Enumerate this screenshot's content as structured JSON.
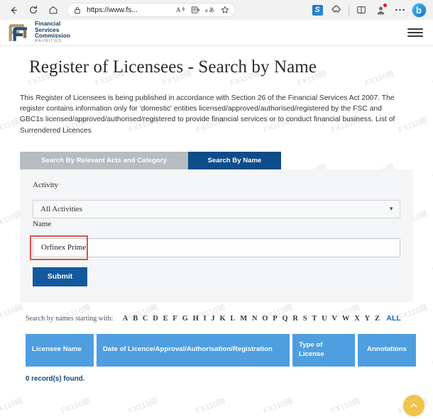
{
  "browser": {
    "back_icon": "back-arrow-icon",
    "reload_icon": "reload-icon",
    "home_icon": "home-icon",
    "lock_icon": "lock-icon",
    "url": "https://www.fs...",
    "read_aloud_icon": "read-aloud-icon",
    "immersive_reader_icon": "immersive-reader-icon",
    "translate_icon": "translate-icon",
    "favorite_icon": "favorite-star-icon",
    "extension_icon_label": "S",
    "extensions_icon": "extensions-puzzle-icon",
    "split_screen_icon": "split-screen-icon",
    "profile_icon": "profile-avatar-icon",
    "settings_more_icon": "more-options-icon",
    "copilot_icon_label": "b"
  },
  "site": {
    "logo": {
      "line1": "Financial",
      "line2": "Services",
      "line3": "Commission",
      "subtitle": "MAURITIUS"
    },
    "menu_icon": "hamburger-menu-icon"
  },
  "main": {
    "title": "Register of Licensees - Search by Name",
    "intro": "This Register of Licensees is being published in accordance with Section 26 of the Financial Services Act 2007. The register contains information only for 'domestic' entities licensed/approved/authorised/registered by the FSC and GBC1s licensed/approved/authorised/registered to provide financial services or to conduct financial business. List of Surrendered Licences",
    "tabs": [
      {
        "label": "Search By Relevant Acts and Category",
        "active": false
      },
      {
        "label": "Search By Name",
        "active": true
      }
    ],
    "form": {
      "activity_label": "Activity",
      "activity_value": "All Activities",
      "activity_caret_icon": "chevron-down-icon",
      "name_label": "Name",
      "name_value": "Orfinex Prime",
      "name_placeholder": "",
      "submit_label": "Submit"
    },
    "alpha": {
      "label": "Search by names starting with:",
      "letters": [
        "A",
        "B",
        "C",
        "D",
        "E",
        "F",
        "G",
        "H",
        "I",
        "J",
        "K",
        "L",
        "M",
        "N",
        "O",
        "P",
        "Q",
        "R",
        "S",
        "T",
        "U",
        "V",
        "W",
        "X",
        "Y",
        "Z"
      ],
      "all_label": "ALL"
    },
    "table": {
      "columns": [
        {
          "label": "Licensee Name"
        },
        {
          "label": "Date of Licence/Approval/Authorisation/Registration"
        },
        {
          "label": "Type of License"
        },
        {
          "label": "Annotations"
        }
      ],
      "rows": [],
      "records_text": "0 record(s) found."
    },
    "scroll_top_icon": "chevron-up-icon"
  },
  "watermark": {
    "text": "FX110网"
  },
  "colors": {
    "tab_active": "#0f4c8a",
    "tab_inactive": "#b6bcc2",
    "submit": "#13599f",
    "table_header": "#4e9ee0",
    "alpha_all_link": "#1565b0",
    "highlight_box": "#d9534f",
    "scroll_top": "#f0c34a",
    "records_text": "#16477c"
  }
}
